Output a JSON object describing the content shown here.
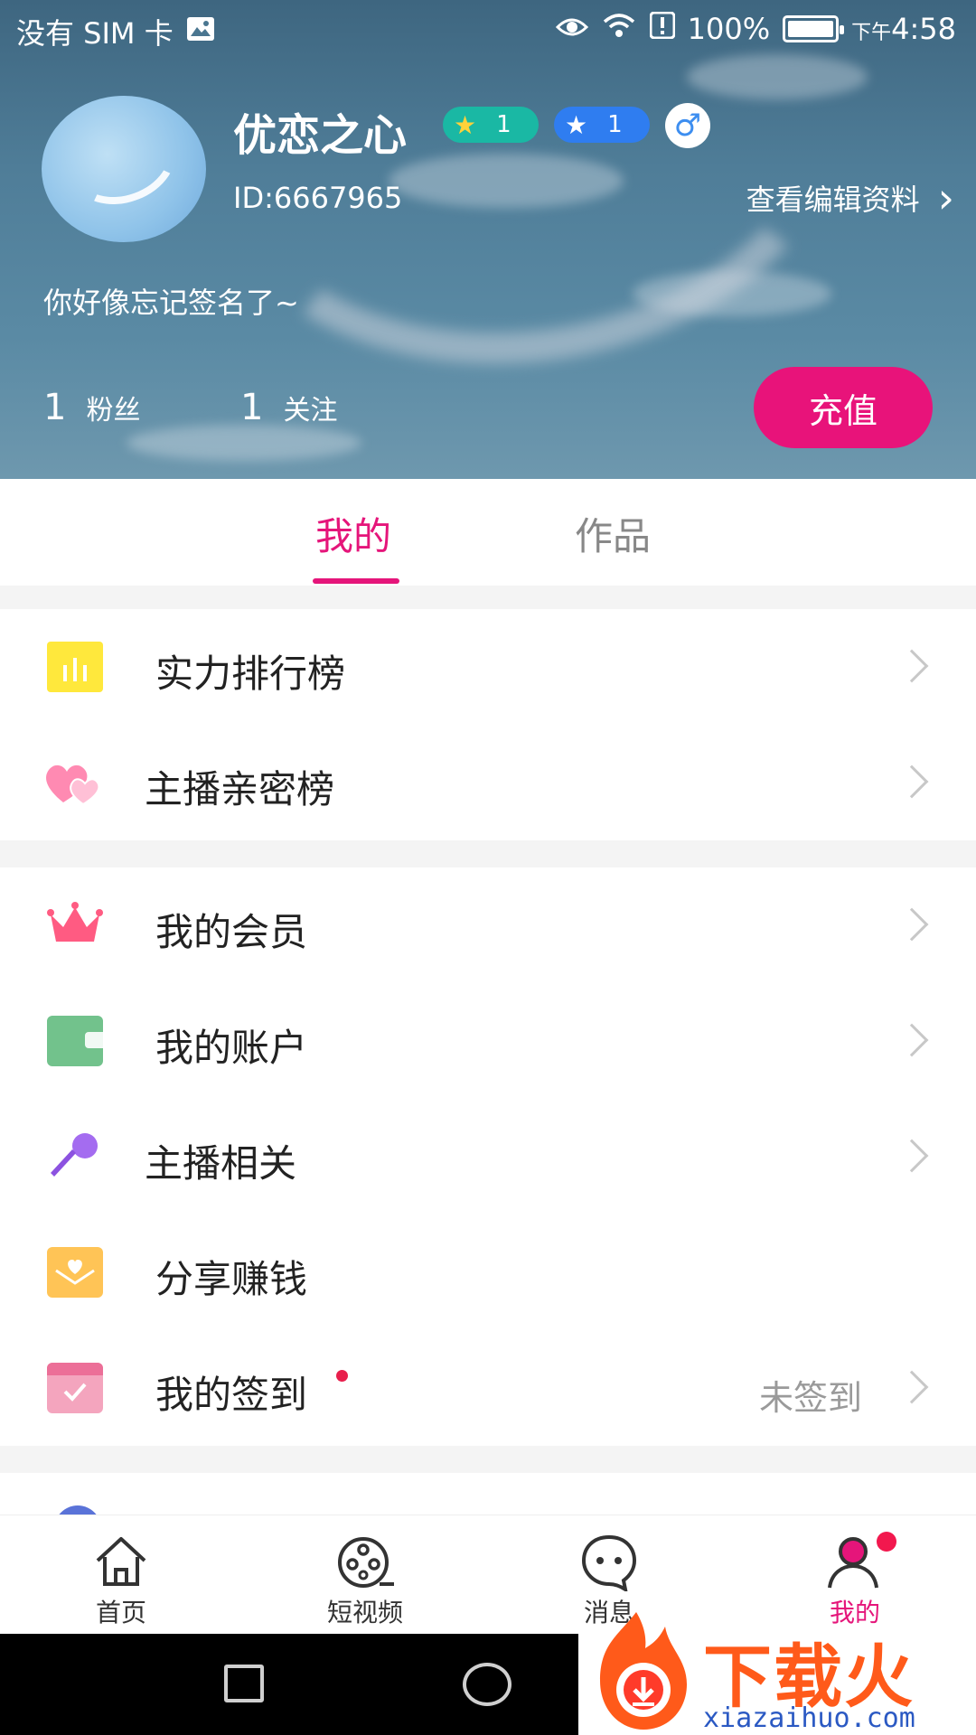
{
  "status_bar": {
    "carrier": "没有 SIM 卡",
    "battery": "100%",
    "period": "下午",
    "time": "4:58"
  },
  "profile": {
    "username": "优恋之心",
    "level_badge": "1",
    "star_badge": "1",
    "gender_symbol": "♂",
    "id": "ID:6667965",
    "edit_link": "查看编辑资料",
    "signature": "你好像忘记签名了~",
    "fans_count": "1",
    "fans_label": "粉丝",
    "follow_count": "1",
    "follow_label": "关注",
    "recharge_label": "充值"
  },
  "tabs": [
    {
      "label": "我的",
      "active": true
    },
    {
      "label": "作品",
      "active": false
    }
  ],
  "menu_group_1": [
    {
      "label": "实力排行榜",
      "icon": "bar-chart-icon"
    },
    {
      "label": "主播亲密榜",
      "icon": "hearts-icon"
    }
  ],
  "menu_group_2": [
    {
      "label": "我的会员",
      "icon": "crown-icon"
    },
    {
      "label": "我的账户",
      "icon": "wallet-icon"
    },
    {
      "label": "主播相关",
      "icon": "microphone-icon"
    },
    {
      "label": "分享赚钱",
      "icon": "envelope-heart-icon"
    },
    {
      "label": "我的签到",
      "icon": "calendar-check-icon",
      "status": "未签到"
    }
  ],
  "bottom_nav": [
    {
      "label": "首页",
      "icon": "home-icon"
    },
    {
      "label": "短视频",
      "icon": "film-reel-icon"
    },
    {
      "label": "消息",
      "icon": "chat-bubble-icon"
    },
    {
      "label": "我的",
      "icon": "user-icon",
      "active": true
    }
  ],
  "watermark": {
    "title": "下载火",
    "url": "xiazaihuo.com"
  },
  "colors": {
    "accent": "#e5157a",
    "recharge": "#e8137a",
    "level_badge": "#1ab8a4",
    "star_badge": "#2f7df0"
  }
}
